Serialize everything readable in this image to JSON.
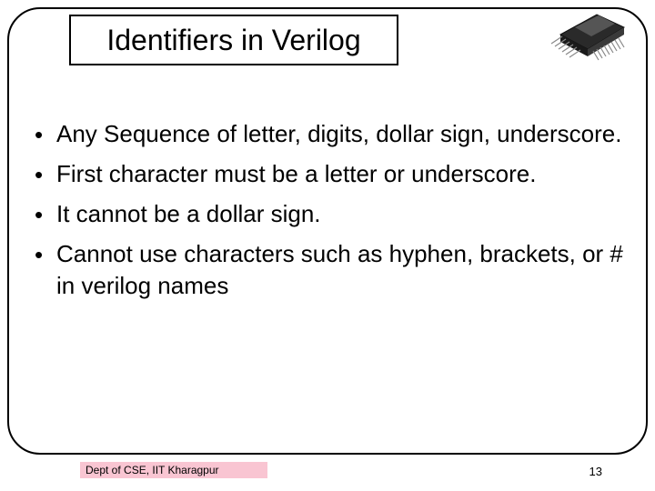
{
  "title": "Identifiers in Verilog",
  "bullets": [
    "Any Sequence of letter, digits, dollar sign, underscore.",
    "First character must be a letter or underscore.",
    "It cannot be a dollar sign.",
    "Cannot use characters such as hyphen, brackets, or # in verilog names"
  ],
  "footer": "Dept of CSE, IIT Kharagpur",
  "page_number": "13"
}
